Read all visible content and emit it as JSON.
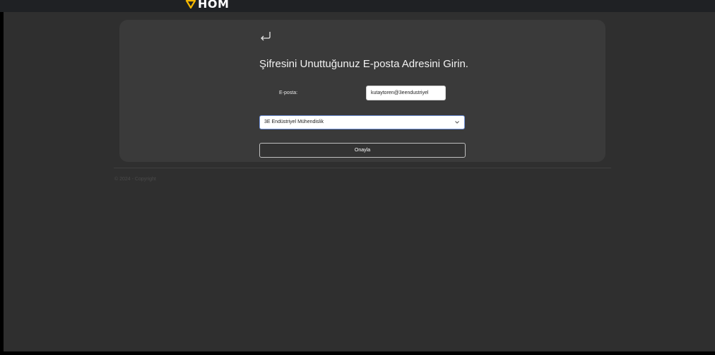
{
  "header": {
    "logo_text": "HOM",
    "logo_icon": "shield-icon",
    "logo_color": "#f5b800"
  },
  "form": {
    "back_icon": "return-arrow-icon",
    "title": "Şifresini Unuttuğunuz E-posta Adresini Girin.",
    "email_label": "E-posta:",
    "email_value": "kutaytoren@3eendustriyel",
    "company_selected": "3E Endüstriyel Mühendislik",
    "confirm_label": "Onayla"
  },
  "footer": {
    "copyright": "© 2024 - Copyright"
  },
  "colors": {
    "page_bg": "#2f2f2f",
    "card_bg": "#3a3a3a",
    "topbar_bg": "#1f2124"
  }
}
